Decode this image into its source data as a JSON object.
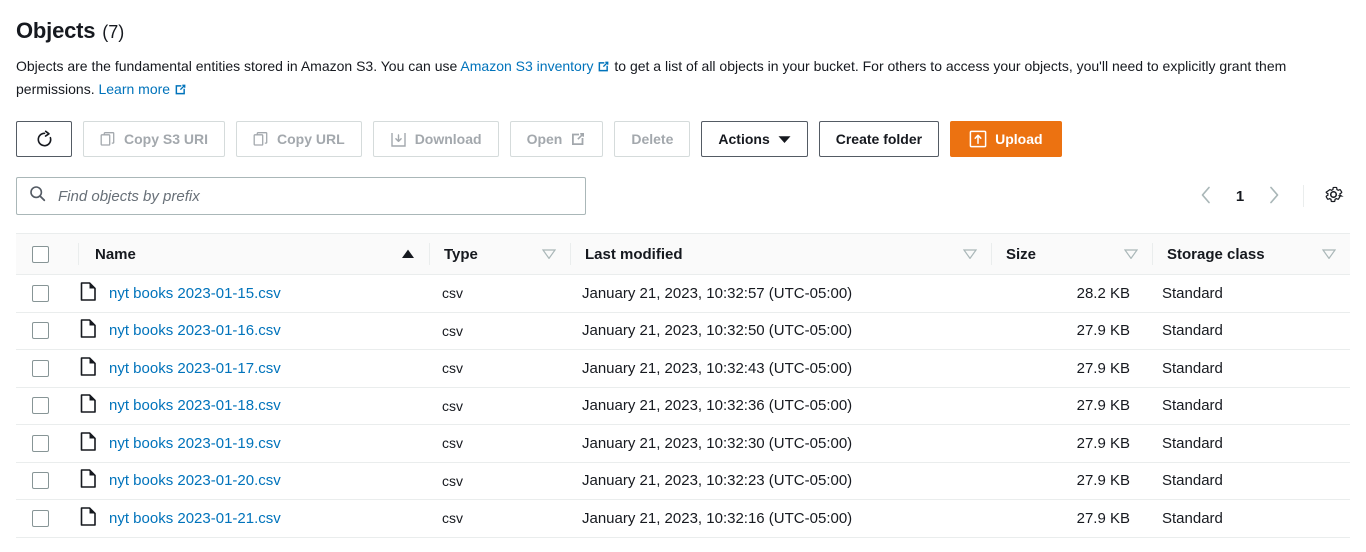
{
  "header": {
    "title": "Objects",
    "count": "(7)",
    "description_part1": "Objects are the fundamental entities stored in Amazon S3. You can use ",
    "inventory_link": "Amazon S3 inventory",
    "description_part2": " to get a list of all objects in your bucket. For others to access your objects, you'll need to explicitly grant them permissions. ",
    "learn_more_link": "Learn more"
  },
  "toolbar": {
    "refresh_label": "",
    "copy_s3_uri": "Copy S3 URI",
    "copy_url": "Copy URL",
    "download": "Download",
    "open": "Open",
    "delete": "Delete",
    "actions": "Actions",
    "create_folder": "Create folder",
    "upload": "Upload",
    "accent_color": "#ec7211"
  },
  "search": {
    "placeholder": "Find objects by prefix",
    "value": ""
  },
  "pagination": {
    "current_page": "1"
  },
  "table": {
    "columns": [
      {
        "label": "Name",
        "sort": "asc"
      },
      {
        "label": "Type",
        "sort": "none"
      },
      {
        "label": "Last modified",
        "sort": "none"
      },
      {
        "label": "Size",
        "sort": "none"
      },
      {
        "label": "Storage class",
        "sort": "none"
      }
    ],
    "rows": [
      {
        "name": "nyt books 2023-01-15.csv",
        "type": "csv",
        "last_modified": "January 21, 2023, 10:32:57 (UTC-05:00)",
        "size": "28.2 KB",
        "storage_class": "Standard"
      },
      {
        "name": "nyt books 2023-01-16.csv",
        "type": "csv",
        "last_modified": "January 21, 2023, 10:32:50 (UTC-05:00)",
        "size": "27.9 KB",
        "storage_class": "Standard"
      },
      {
        "name": "nyt books 2023-01-17.csv",
        "type": "csv",
        "last_modified": "January 21, 2023, 10:32:43 (UTC-05:00)",
        "size": "27.9 KB",
        "storage_class": "Standard"
      },
      {
        "name": "nyt books 2023-01-18.csv",
        "type": "csv",
        "last_modified": "January 21, 2023, 10:32:36 (UTC-05:00)",
        "size": "27.9 KB",
        "storage_class": "Standard"
      },
      {
        "name": "nyt books 2023-01-19.csv",
        "type": "csv",
        "last_modified": "January 21, 2023, 10:32:30 (UTC-05:00)",
        "size": "27.9 KB",
        "storage_class": "Standard"
      },
      {
        "name": "nyt books 2023-01-20.csv",
        "type": "csv",
        "last_modified": "January 21, 2023, 10:32:23 (UTC-05:00)",
        "size": "27.9 KB",
        "storage_class": "Standard"
      },
      {
        "name": "nyt books 2023-01-21.csv",
        "type": "csv",
        "last_modified": "January 21, 2023, 10:32:16 (UTC-05:00)",
        "size": "27.9 KB",
        "storage_class": "Standard"
      }
    ]
  },
  "icons": {
    "refresh": "refresh-icon",
    "copy": "copy-icon",
    "download": "download-icon",
    "external": "external-link-icon",
    "upload": "upload-icon",
    "search": "search-icon",
    "gear": "gear-icon",
    "file": "file-icon",
    "chevron_left": "chevron-left-icon",
    "chevron_right": "chevron-right-icon"
  }
}
